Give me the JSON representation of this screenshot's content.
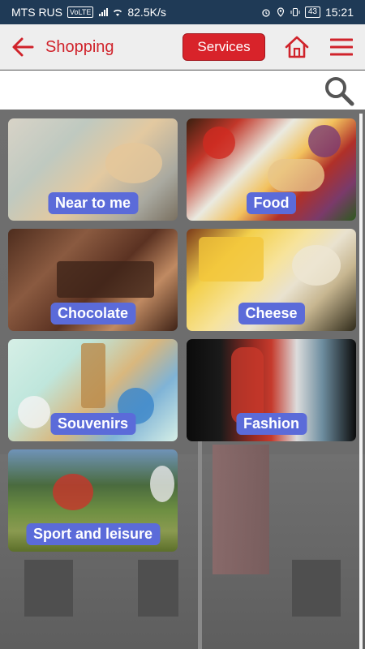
{
  "status_bar": {
    "carrier": "MTS RUS",
    "volte": "VoLTE",
    "speed": "82.5K/s",
    "battery": "43",
    "time": "15:21"
  },
  "app_bar": {
    "title": "Shopping",
    "services_label": "Services",
    "accent_color": "#d8232a"
  },
  "search": {
    "value": "",
    "placeholder": ""
  },
  "tiles": [
    {
      "label": "Near to me"
    },
    {
      "label": "Food"
    },
    {
      "label": "Chocolate"
    },
    {
      "label": "Cheese"
    },
    {
      "label": "Souvenirs"
    },
    {
      "label": "Fashion"
    },
    {
      "label": "Sport and leisure"
    }
  ],
  "icons": [
    "back-arrow-icon",
    "home-icon",
    "menu-icon",
    "search-icon",
    "wifi-icon",
    "signal-icon",
    "alarm-icon",
    "location-icon",
    "vibrate-icon"
  ]
}
